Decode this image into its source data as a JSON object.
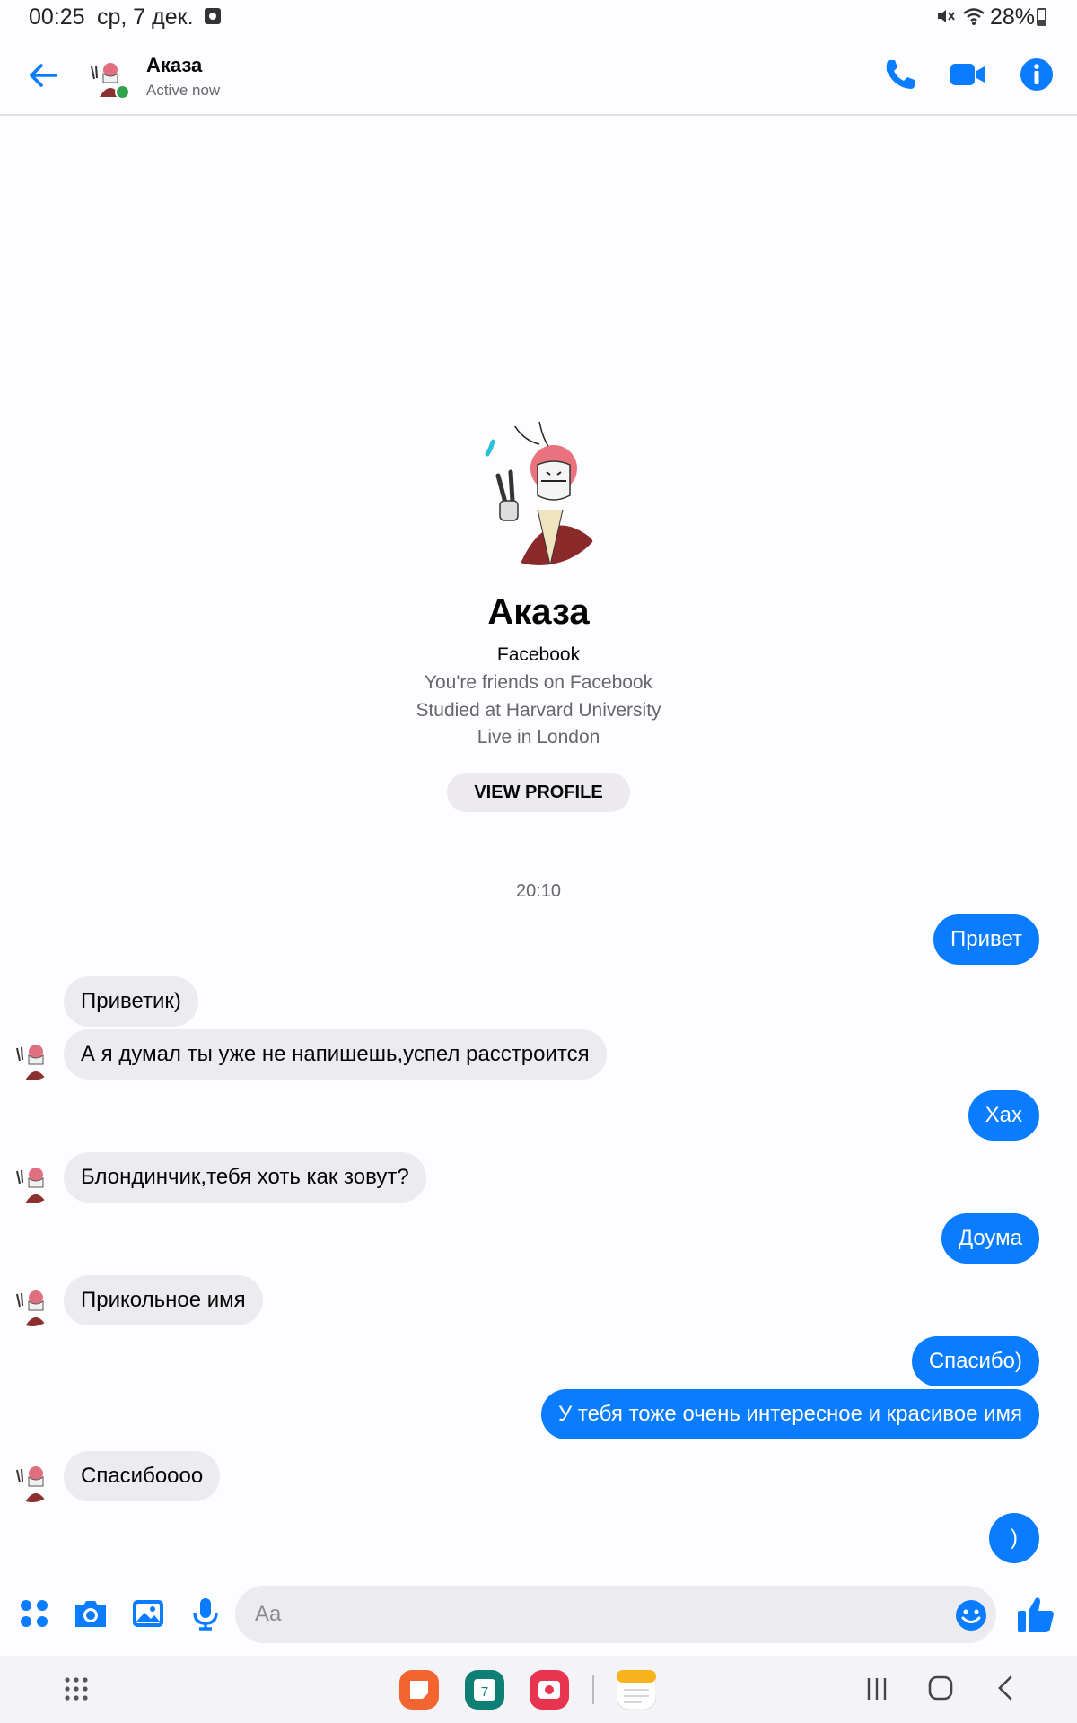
{
  "status_bar": {
    "time": "00:25",
    "date": "ср, 7 дек.",
    "battery": "28%"
  },
  "header": {
    "contact_name": "Аказа",
    "presence": "Active now",
    "icons": [
      "back-arrow-icon",
      "phone-icon",
      "video-camera-icon",
      "info-icon"
    ],
    "accent_color": "#0a7cff"
  },
  "profile": {
    "name": "Аказа",
    "platform": "Facebook",
    "details": [
      "You're friends on Facebook",
      "Studied at Harvard University",
      "Live in London"
    ],
    "view_profile_label": "VIEW PROFILE"
  },
  "conversation": {
    "timestamp": "20:10",
    "messages": [
      {
        "side": "out",
        "text": "Привет"
      },
      {
        "side": "in",
        "text": "Приветик)"
      },
      {
        "side": "in",
        "text": "А я думал ты уже не напишешь,успел расстроится"
      },
      {
        "side": "out",
        "text": "Хах"
      },
      {
        "side": "in",
        "text": "Блондинчик,тебя хоть как зовут?"
      },
      {
        "side": "out",
        "text": "Доума"
      },
      {
        "side": "in",
        "text": "Прикольное имя"
      },
      {
        "side": "out",
        "text": "Спасибо)"
      },
      {
        "side": "out",
        "text": "У тебя тоже очень интересное и красивое имя"
      },
      {
        "side": "in",
        "text": "Спасибоооо"
      },
      {
        "side": "out",
        "text": ")"
      }
    ]
  },
  "composer": {
    "placeholder": "Aa",
    "value": "",
    "icons": [
      "apps-icon",
      "camera-icon",
      "gallery-icon",
      "microphone-icon",
      "emoji-icon",
      "thumbs-up-icon"
    ]
  },
  "nav_bar": {
    "taskbar_apps": [
      "notes-app-icon",
      "calendar-app-icon",
      "screen-recorder-app-icon",
      "memo-app-icon"
    ],
    "calendar_day": "7"
  }
}
